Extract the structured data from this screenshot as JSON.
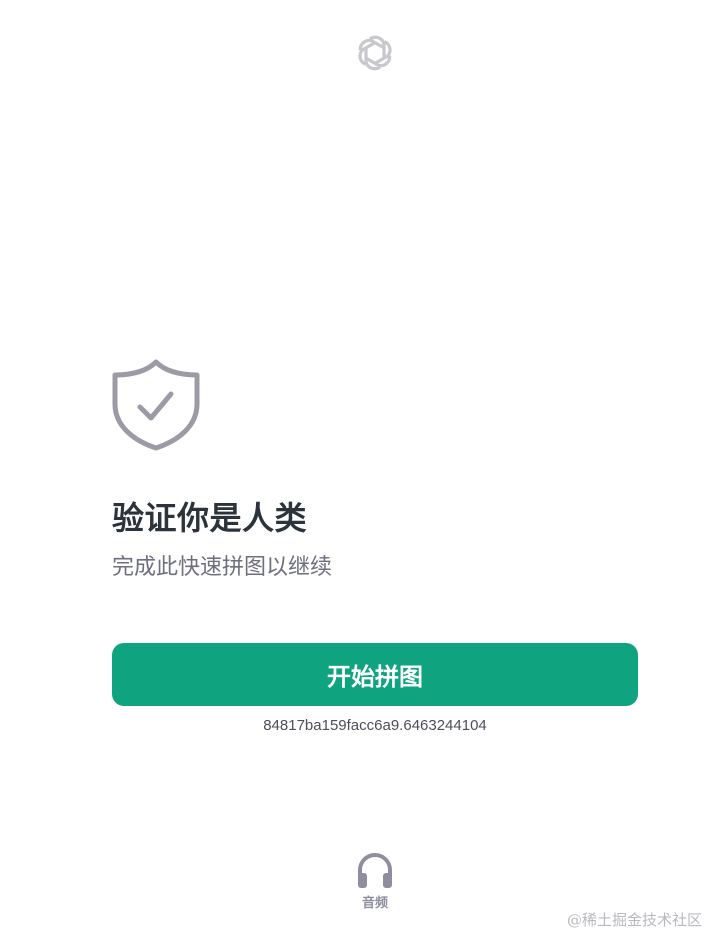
{
  "logo": {
    "icon": "openai-logo-icon",
    "color": "#c8c8cc"
  },
  "shield": {
    "icon": "shield-check-icon",
    "color": "#9c9ba5"
  },
  "challenge": {
    "title": "验证你是人类",
    "subtitle": "完成此快速拼图以继续",
    "start_button_label": "开始拼图",
    "session_id": "84817ba159facc6a9.6463244104"
  },
  "audio": {
    "icon": "headphones-icon",
    "label": "音频"
  },
  "watermark": "@稀土掘金技术社区",
  "colors": {
    "accent": "#10a37f",
    "title": "#2d333a",
    "subtitle": "#6e6e80",
    "icon_gray": "#9c9ba5"
  }
}
